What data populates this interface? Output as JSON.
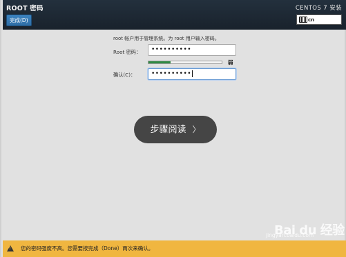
{
  "header": {
    "title": "ROOT 密码",
    "done_label": "完成(D)",
    "os_title": "CENTOS 7 安装",
    "keyboard_layout": "cn"
  },
  "form": {
    "description": "root 帐户用于管理系统。为 root 用户输入密码。",
    "root_label": "Root 密码：",
    "root_value": "••••••••••",
    "strength_label": "弱",
    "strength_level": 0.3,
    "strength_color": "#2f8a43",
    "confirm_label": "确认(C)：",
    "confirm_value": "••••••••••"
  },
  "overlay": {
    "step_label": "步骤阅读",
    "chevron": "〉"
  },
  "footer": {
    "warning_text": "您的密码强度不高。您需要按完成（Done）两次来确认。",
    "bg_color": "#f0b640"
  },
  "watermark": {
    "brand": "Bai du 经验",
    "url": "jingyan.baidu.com"
  }
}
